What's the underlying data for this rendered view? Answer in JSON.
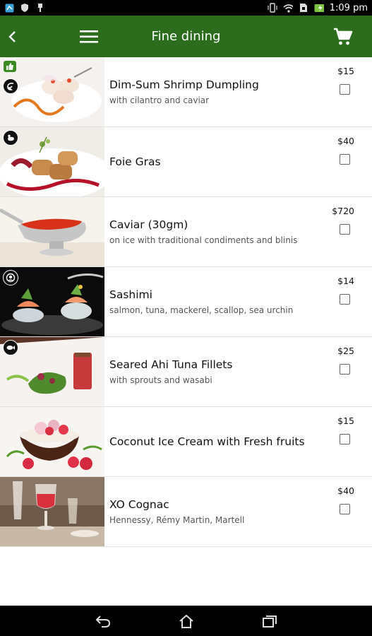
{
  "status": {
    "time": "1:09 pm"
  },
  "app_bar": {
    "title": "Fine dining"
  },
  "colors": {
    "app_bar": "#2b6d1d",
    "status_bar": "#000000",
    "divider": "#e1e1e1"
  },
  "menu_items": [
    {
      "name": "Dim-Sum Shrimp Dumpling",
      "description": "with cilantro and caviar",
      "price": "$15",
      "badges": [
        "thumbs-up-icon",
        "shrimp-icon"
      ],
      "checked": false
    },
    {
      "name": "Foie Gras",
      "description": "",
      "price": "$40",
      "badges": [
        "duck-icon"
      ],
      "checked": false
    },
    {
      "name": "Caviar (30gm)",
      "description": "on ice with traditional condiments and blinis",
      "price": "$720",
      "badges": [],
      "checked": false
    },
    {
      "name": "Sashimi",
      "description": "salmon, tuna, mackerel, scallop, sea urchin",
      "price": "$14",
      "badges": [
        "chef-icon"
      ],
      "checked": false
    },
    {
      "name": "Seared Ahi Tuna Fillets",
      "description": "with sprouts and wasabi",
      "price": "$25",
      "badges": [
        "fish-icon"
      ],
      "checked": false
    },
    {
      "name": "Coconut Ice Cream with Fresh fruits",
      "description": "",
      "price": "$15",
      "badges": [],
      "checked": false
    },
    {
      "name": "XO Cognac",
      "description": "Hennessy, Rémy Martin, Martell",
      "price": "$40",
      "badges": [],
      "checked": false
    }
  ]
}
